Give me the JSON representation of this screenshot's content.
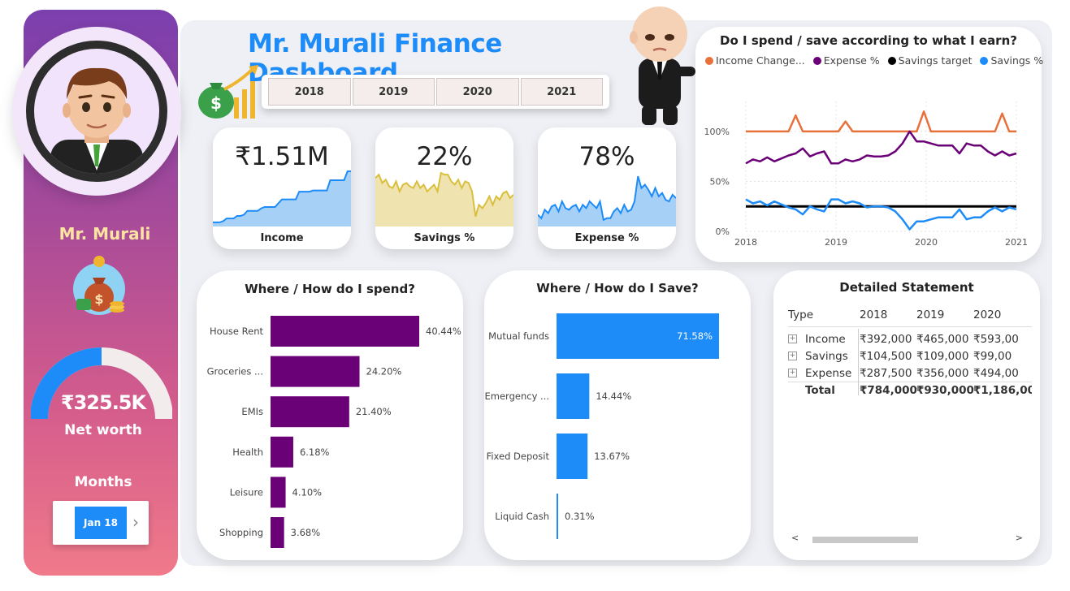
{
  "colors": {
    "accent": "#1d8cf8",
    "purple": "#6a0177",
    "orange": "#e8703a",
    "gold": "#e8d89c",
    "expense_blue": "#8ec2f3"
  },
  "sidebar": {
    "user_name": "Mr. Murali",
    "net_worth_value": "₹325.5K",
    "net_worth_label": "Net worth",
    "net_worth_fraction": 0.5,
    "months_title": "Months",
    "month_selected": "Jan 18"
  },
  "header": {
    "title": "Mr. Murali Finance Dashboard",
    "years": [
      "2018",
      "2019",
      "2020",
      "2021"
    ]
  },
  "kpis": {
    "income": {
      "value": "₹1.51M",
      "label": "Income"
    },
    "savings": {
      "value": "22%",
      "label": "Savings %"
    },
    "expense": {
      "value": "78%",
      "label": "Expense %"
    }
  },
  "line_chart": {
    "title": "Do I spend / save according to what I earn?",
    "legend": [
      "Income Change...",
      "Expense %",
      "Savings target",
      "Savings %"
    ]
  },
  "spend_chart": {
    "title": "Where / How do I spend?"
  },
  "save_chart": {
    "title": "Where / How do I Save?"
  },
  "statement": {
    "title": "Detailed Statement",
    "columns": [
      "Type",
      "2018",
      "2019",
      "2020"
    ],
    "rows": [
      {
        "type": "Income",
        "v2018": "₹392,000",
        "v2019": "₹465,000",
        "v2020": "₹593,00"
      },
      {
        "type": "Savings",
        "v2018": "₹104,500",
        "v2019": "₹109,000",
        "v2020": "₹99,00"
      },
      {
        "type": "Expense",
        "v2018": "₹287,500",
        "v2019": "₹356,000",
        "v2020": "₹494,00"
      }
    ],
    "total": {
      "type": "Total",
      "v2018": "₹784,000",
      "v2019": "₹930,000",
      "v2020": "₹1,186,00"
    }
  },
  "chart_data": [
    {
      "type": "line",
      "title": "Do I spend / save according to what I earn?",
      "x_ticks": [
        "2018",
        "2019",
        "2020",
        "2021"
      ],
      "y_ticks": [
        "0%",
        "50%",
        "100%"
      ],
      "ylim": [
        0,
        130
      ],
      "legend_position": "top",
      "series": [
        {
          "name": "Income Change...",
          "color": "#e8703a",
          "values": [
            100,
            100,
            100,
            100,
            100,
            100,
            100,
            116,
            100,
            100,
            100,
            100,
            100,
            100,
            110,
            100,
            100,
            100,
            100,
            100,
            100,
            100,
            100,
            100,
            100,
            120,
            100,
            100,
            100,
            100,
            100,
            100,
            100,
            100,
            100,
            100,
            118,
            100,
            100
          ]
        },
        {
          "name": "Expense %",
          "color": "#6a0177",
          "values": [
            68,
            72,
            70,
            74,
            70,
            73,
            76,
            78,
            83,
            75,
            78,
            80,
            68,
            68,
            72,
            70,
            72,
            76,
            75,
            75,
            76,
            80,
            88,
            100,
            90,
            90,
            88,
            86,
            86,
            86,
            78,
            88,
            86,
            86,
            80,
            76,
            80,
            76,
            78
          ]
        },
        {
          "name": "Savings target",
          "color": "#000000",
          "values": [
            25,
            25,
            25,
            25,
            25,
            25,
            25,
            25,
            25,
            25,
            25,
            25,
            25,
            25,
            25,
            25,
            25,
            25,
            25,
            25,
            25,
            25,
            25,
            25,
            25,
            25,
            25,
            25,
            25,
            25,
            25,
            25,
            25,
            25,
            25,
            25,
            25,
            25,
            25
          ]
        },
        {
          "name": "Savings %",
          "color": "#1d8cf8",
          "values": [
            32,
            28,
            30,
            26,
            30,
            27,
            24,
            22,
            17,
            25,
            22,
            20,
            32,
            32,
            28,
            30,
            28,
            24,
            25,
            25,
            24,
            20,
            12,
            2,
            10,
            10,
            12,
            14,
            14,
            14,
            22,
            12,
            14,
            14,
            20,
            24,
            20,
            24,
            22
          ]
        }
      ]
    },
    {
      "type": "bar",
      "title": "Where / How do I spend?",
      "orientation": "horizontal",
      "color": "#6a0177",
      "categories": [
        "House Rent",
        "Groceries ...",
        "EMIs",
        "Health",
        "Leisure",
        "Shopping"
      ],
      "values": [
        40.44,
        24.2,
        21.4,
        6.18,
        4.1,
        3.68
      ],
      "labels": [
        "40.44%",
        "24.20%",
        "21.40%",
        "6.18%",
        "4.10%",
        "3.68%"
      ]
    },
    {
      "type": "bar",
      "title": "Where / How do I Save?",
      "orientation": "horizontal",
      "color": "#1d8cf8",
      "categories": [
        "Mutual funds",
        "Emergency ...",
        "Fixed Deposit",
        "Liquid Cash"
      ],
      "values": [
        71.58,
        14.44,
        13.67,
        0.31
      ],
      "labels": [
        "71.58%",
        "14.44%",
        "13.67%",
        "0.31%"
      ]
    },
    {
      "type": "area",
      "title": "Income",
      "color": "#8ec2f3",
      "values": [
        2,
        2,
        2,
        3,
        5,
        5,
        5,
        7,
        7,
        8,
        11,
        11,
        11,
        11,
        13,
        14,
        14,
        14,
        14,
        17,
        20,
        20,
        20,
        20,
        20,
        26,
        26,
        26,
        26,
        27,
        27,
        27,
        27,
        27,
        35,
        35,
        35,
        35,
        35,
        42,
        42
      ]
    },
    {
      "type": "area",
      "title": "Savings %",
      "color": "#e8d89c",
      "values": [
        28,
        30,
        25,
        27,
        23,
        22,
        26,
        20,
        24,
        25,
        23,
        22,
        26,
        22,
        24,
        20,
        22,
        24,
        20,
        31,
        30,
        30,
        26,
        24,
        27,
        22,
        26,
        25,
        20,
        5,
        12,
        10,
        13,
        17,
        12,
        17,
        15,
        19,
        20,
        16,
        18
      ]
    },
    {
      "type": "area",
      "title": "Expense %",
      "color": "#8ec2f3",
      "values": [
        72,
        70,
        75,
        73,
        77,
        78,
        74,
        80,
        76,
        75,
        77,
        78,
        74,
        78,
        76,
        80,
        78,
        76,
        80,
        69,
        70,
        70,
        74,
        76,
        73,
        78,
        74,
        75,
        80,
        95,
        88,
        90,
        87,
        83,
        88,
        83,
        85,
        81,
        80,
        84,
        82
      ]
    }
  ]
}
